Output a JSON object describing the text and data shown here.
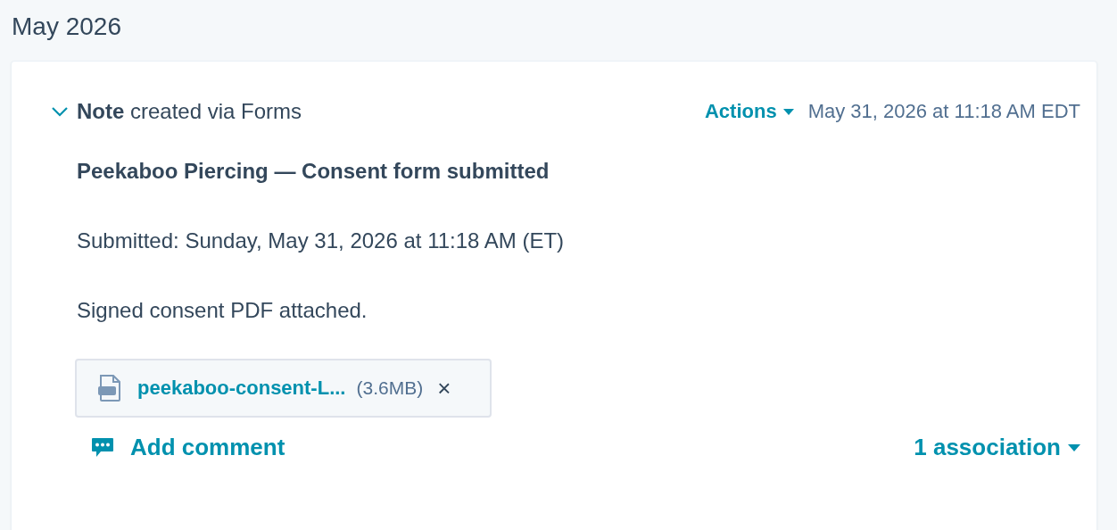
{
  "month": "May 2026",
  "note": {
    "expanded": true,
    "heading": "**Note** created via Forms",
    "actions_label": "Actions",
    "timestamp": "May 31, 2026 at 11:18 AM EDT",
    "title": "Peekaboo Piercing — Consent form submitted",
    "paragraphs": [
      "Submitted: Sunday, May 31, 2026 at 11:18 AM (ET)",
      "Signed consent PDF attached."
    ],
    "attachment": {
      "name": "peekaboo-consent-L...",
      "size": "(3.6MB)",
      "remove": "×"
    },
    "comment_label": "Add comment",
    "associations": "1 association"
  }
}
